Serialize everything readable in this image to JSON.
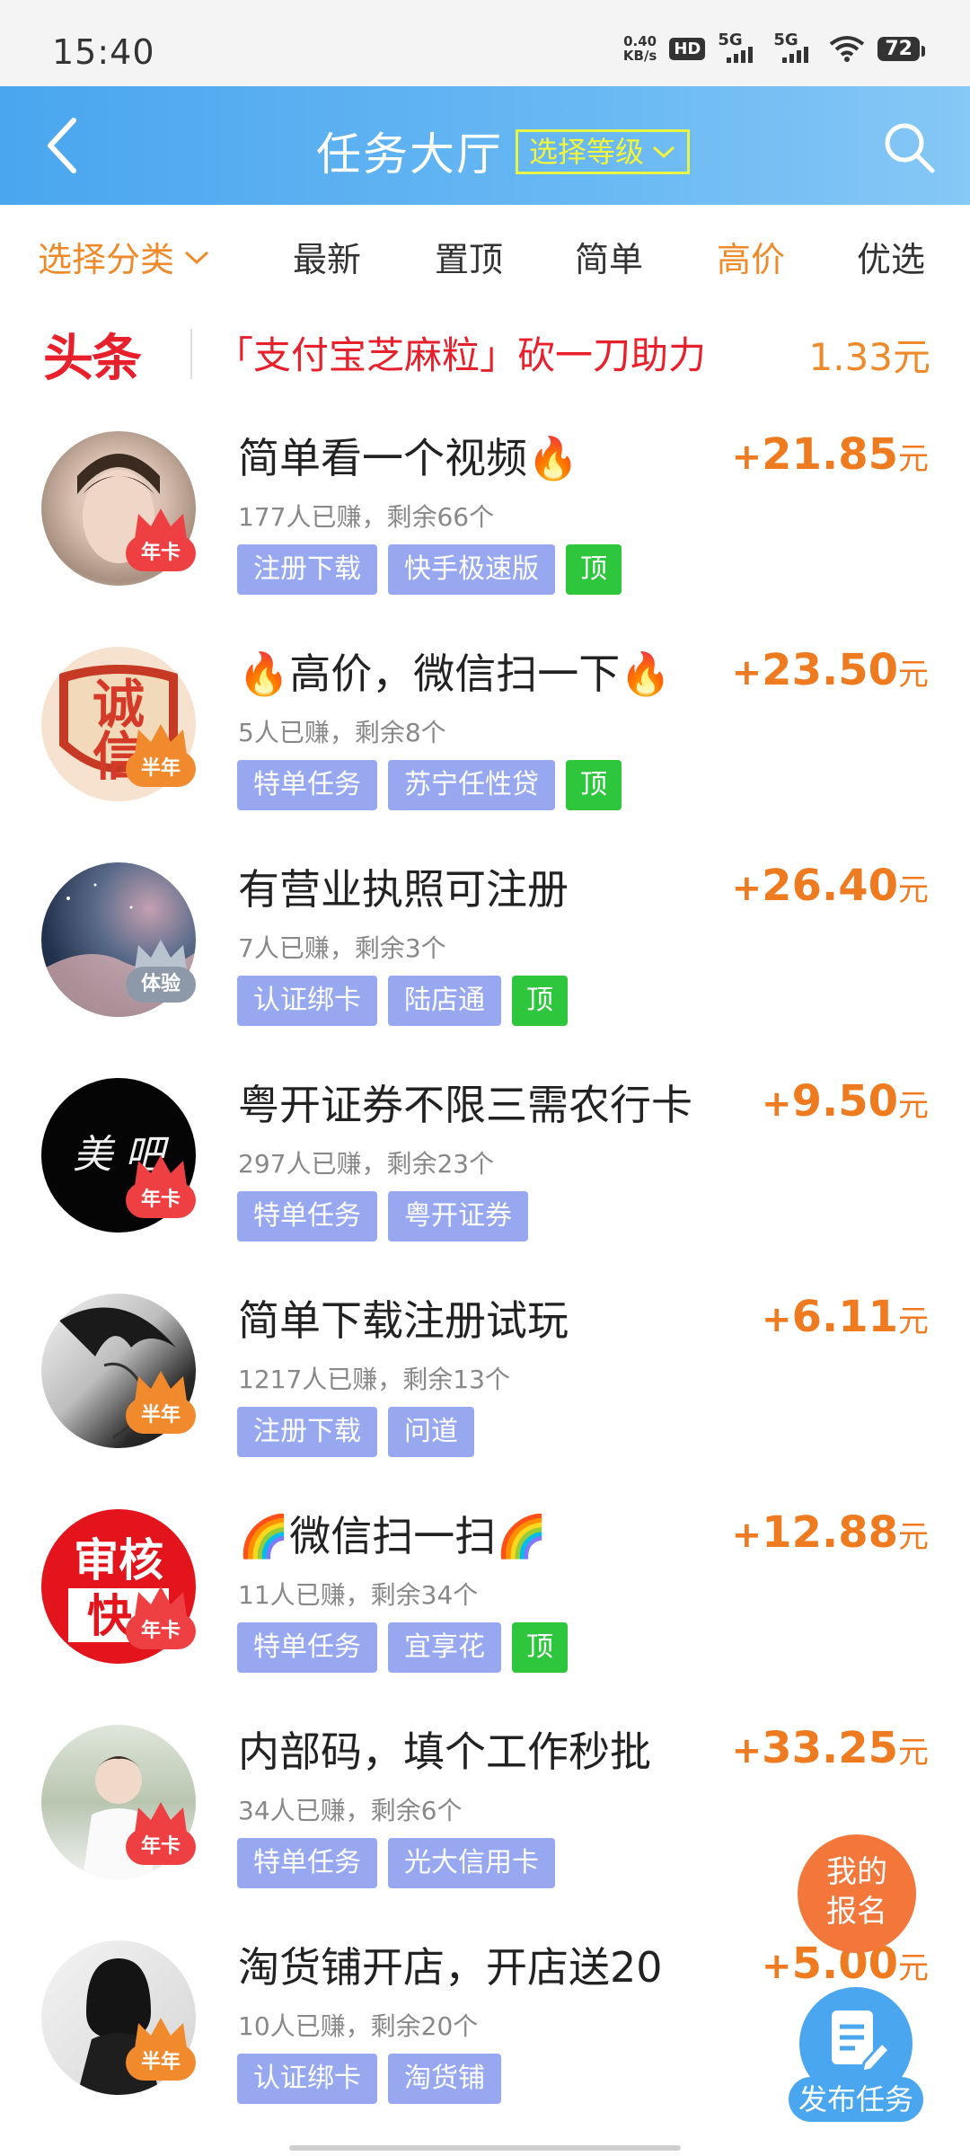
{
  "status_bar": {
    "time": "15:40",
    "net_speed_value": "0.40",
    "net_speed_unit": "KB/s",
    "hd": "HD",
    "sim1": "5G",
    "sim2": "5G",
    "battery": "72"
  },
  "header": {
    "title": "任务大厅",
    "level_select": "选择等级"
  },
  "tabs": {
    "category": "选择分类",
    "items": [
      "最新",
      "置顶",
      "简单",
      "高价",
      "优选"
    ],
    "active": "高价"
  },
  "headline": {
    "logo": "头条",
    "text": "「支付宝芝麻粒」砍一刀助力",
    "price": "1.33元"
  },
  "tasks": [
    {
      "title": "简单看一个视频🔥",
      "stats": "177人已赚，剩余66个",
      "price": "21.85",
      "badge": "年卡",
      "tags": [
        "注册下载",
        "快手极速版",
        "顶"
      ]
    },
    {
      "title": "🔥高价，微信扫一下🔥",
      "stats": "5人已赚，剩余8个",
      "price": "23.50",
      "badge": "半年",
      "tags": [
        "特单任务",
        "苏宁任性贷",
        "顶"
      ]
    },
    {
      "title": "有营业执照可注册",
      "stats": "7人已赚，剩余3个",
      "price": "26.40",
      "badge": "体验",
      "tags": [
        "认证绑卡",
        "陆店通",
        "顶"
      ]
    },
    {
      "title": "粤开证券不限三需农行卡",
      "stats": "297人已赚，剩余23个",
      "price": "9.50",
      "badge": "年卡",
      "tags": [
        "特单任务",
        "粤开证券"
      ]
    },
    {
      "title": "简单下载注册试玩",
      "stats": "1217人已赚，剩余13个",
      "price": "6.11",
      "badge": "半年",
      "tags": [
        "注册下载",
        "问道"
      ]
    },
    {
      "title": "🌈微信扫一扫🌈",
      "stats": "11人已赚，剩余34个",
      "price": "12.88",
      "badge": "年卡",
      "tags": [
        "特单任务",
        "宜享花",
        "顶"
      ]
    },
    {
      "title": "内部码，填个工作秒批",
      "stats": "34人已赚，剩余6个",
      "price": "33.25",
      "badge": "年卡",
      "tags": [
        "特单任务",
        "光大信用卡"
      ]
    },
    {
      "title": "淘货铺开店，开店送20",
      "stats": "10人已赚，剩余20个",
      "price": "5.00",
      "badge": "半年",
      "tags": [
        "认证绑卡",
        "淘货铺"
      ]
    }
  ],
  "currency": {
    "plus": "+",
    "unit": "元"
  },
  "avatar_texts": {
    "a2_top": "诚",
    "a2_bottom": "信",
    "a4": "美 吧",
    "a6_top": "审核",
    "a6_bottom": "快"
  },
  "fab": {
    "signup_line1": "我的",
    "signup_line2": "报名",
    "publish": "发布任务"
  },
  "colors": {
    "header_blue": "#4aa6ef",
    "accent_orange": "#ef8a2a",
    "price_orange": "#ef7b20",
    "headline_red": "#e8202b",
    "tag_blue": "#97a8f0",
    "tag_green": "#2ec63c"
  }
}
